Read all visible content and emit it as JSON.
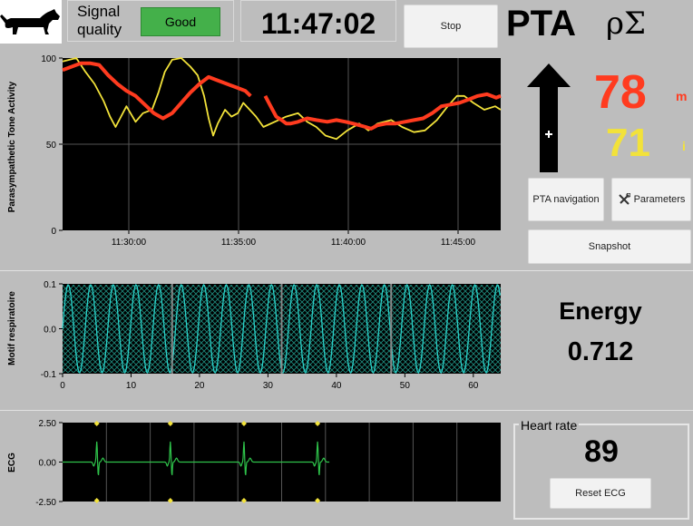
{
  "header": {
    "signal_label": "Signal\nquality",
    "signal_status": "Good",
    "clock": "11:47:02",
    "stop_label": "Stop",
    "pta_label": "PTA",
    "pta_symbol": "ρΣ"
  },
  "values": {
    "pta_mean": "78",
    "pta_mean_unit": "m",
    "pta_instant": "71",
    "pta_instant_unit": "i",
    "energy_label": "Energy",
    "energy_value": "0.712",
    "heart_rate_label": "Heart rate",
    "heart_rate_value": "89"
  },
  "buttons": {
    "pta_navigation": "PTA navigation",
    "parameters": "Parameters",
    "snapshot": "Snapshot",
    "reset_ecg": "Reset ECG"
  },
  "colors": {
    "signal_good": "#44b04a",
    "pta_mean": "#ff3b1f",
    "pta_instant": "#f2e23a",
    "respiratory": "#2ad1c9",
    "ecg": "#2ec24a",
    "ecg_marker": "#f2e23a",
    "trend_arrow": "#000000"
  },
  "icons": {
    "logo": "dachshund-dog-icon",
    "parameters": "tools-icon",
    "trend": "arrow-up-icon"
  },
  "chart_data": [
    {
      "type": "line",
      "ylabel": "Parasympathetic Tone Activity",
      "ylim": [
        0,
        100
      ],
      "yticks": [
        "100",
        "50",
        "0"
      ],
      "xticks": [
        "11:30:00",
        "11:35:00",
        "11:40:00",
        "11:45:00"
      ],
      "grid": true,
      "series": [
        {
          "color": "pta_instant",
          "points": [
            [
              0,
              98
            ],
            [
              15,
              100
            ],
            [
              25,
              92
            ],
            [
              35,
              85
            ],
            [
              45,
              75
            ],
            [
              52,
              66
            ],
            [
              58,
              60
            ],
            [
              63,
              65
            ],
            [
              70,
              72
            ],
            [
              80,
              63
            ],
            [
              88,
              68
            ],
            [
              98,
              70
            ],
            [
              105,
              80
            ],
            [
              112,
              92
            ],
            [
              120,
              99
            ],
            [
              130,
              100
            ],
            [
              140,
              95
            ],
            [
              148,
              90
            ],
            [
              155,
              78
            ],
            [
              160,
              65
            ],
            [
              165,
              55
            ],
            [
              170,
              62
            ],
            [
              178,
              70
            ],
            [
              185,
              66
            ],
            [
              192,
              68
            ],
            [
              198,
              74
            ],
            [
              205,
              70
            ],
            [
              212,
              66
            ],
            [
              220,
              60
            ],
            [
              230,
              56
            ],
            [
              245,
              66
            ],
            [
              258,
              68
            ],
            [
              268,
              63
            ],
            [
              278,
              60
            ],
            [
              288,
              55
            ],
            [
              300,
              53
            ],
            [
              312,
              58
            ],
            [
              325,
              62
            ],
            [
              335,
              58
            ],
            [
              345,
              62
            ],
            [
              360,
              64
            ],
            [
              372,
              60
            ],
            [
              385,
              57
            ],
            [
              397,
              58
            ],
            [
              410,
              64
            ],
            [
              422,
              72
            ],
            [
              432,
              78
            ],
            [
              440,
              78
            ],
            [
              450,
              74
            ],
            [
              462,
              70
            ],
            [
              474,
              72
            ],
            [
              480,
              70
            ]
          ],
          "breaks": [
            [
              225,
              240
            ]
          ]
        },
        {
          "color": "pta_mean",
          "points": [
            [
              0,
              93
            ],
            [
              10,
              95
            ],
            [
              20,
              97
            ],
            [
              30,
              97
            ],
            [
              40,
              96
            ],
            [
              50,
              90
            ],
            [
              60,
              85
            ],
            [
              70,
              81
            ],
            [
              80,
              78
            ],
            [
              90,
              73
            ],
            [
              100,
              68
            ],
            [
              110,
              65
            ],
            [
              120,
              68
            ],
            [
              130,
              74
            ],
            [
              140,
              80
            ],
            [
              150,
              85
            ],
            [
              160,
              89
            ],
            [
              170,
              87
            ],
            [
              180,
              85
            ],
            [
              190,
              83
            ],
            [
              200,
              81
            ],
            [
              206,
              78
            ],
            [
              222,
              78
            ],
            [
              228,
              72
            ],
            [
              234,
              66
            ],
            [
              240,
              64
            ],
            [
              245,
              62
            ],
            [
              250,
              62
            ],
            [
              258,
              63
            ],
            [
              268,
              65
            ],
            [
              278,
              64
            ],
            [
              290,
              63
            ],
            [
              300,
              64
            ],
            [
              310,
              63
            ],
            [
              318,
              62
            ],
            [
              325,
              61
            ],
            [
              332,
              60
            ],
            [
              338,
              59
            ],
            [
              345,
              61
            ],
            [
              355,
              62
            ],
            [
              365,
              62
            ],
            [
              375,
              63
            ],
            [
              385,
              64
            ],
            [
              395,
              65
            ],
            [
              405,
              68
            ],
            [
              415,
              72
            ],
            [
              425,
              73
            ],
            [
              435,
              74
            ],
            [
              445,
              76
            ],
            [
              455,
              78
            ],
            [
              465,
              79
            ],
            [
              475,
              77
            ],
            [
              480,
              78
            ]
          ],
          "breaks": [
            [
              206,
              222
            ]
          ]
        }
      ]
    },
    {
      "type": "line",
      "ylabel": "Motif respiratoire",
      "xlim": [
        0,
        64
      ],
      "ylim": [
        -0.1,
        0.1
      ],
      "xticks": [
        "0",
        "10",
        "20",
        "30",
        "40",
        "50",
        "60"
      ],
      "yticks": [
        "0.1",
        "0.0",
        "-0.1"
      ],
      "period": 3.3,
      "amplitude": 0.1,
      "segment_boundaries": [
        16,
        32,
        48
      ]
    },
    {
      "type": "line",
      "ylabel": "ECG",
      "ylim": [
        -2.5,
        2.5
      ],
      "yticks": [
        "2.50",
        "0.00",
        "-2.50"
      ],
      "beats": [
        3.9,
        12.3,
        20.7,
        29.1
      ],
      "trace_end": 30.5,
      "xlim": [
        0,
        50
      ],
      "grid_x": [
        5,
        10,
        15,
        20,
        25,
        30,
        35,
        40,
        45
      ],
      "markers": [
        3.9,
        12.3,
        20.7,
        29.1
      ]
    }
  ]
}
